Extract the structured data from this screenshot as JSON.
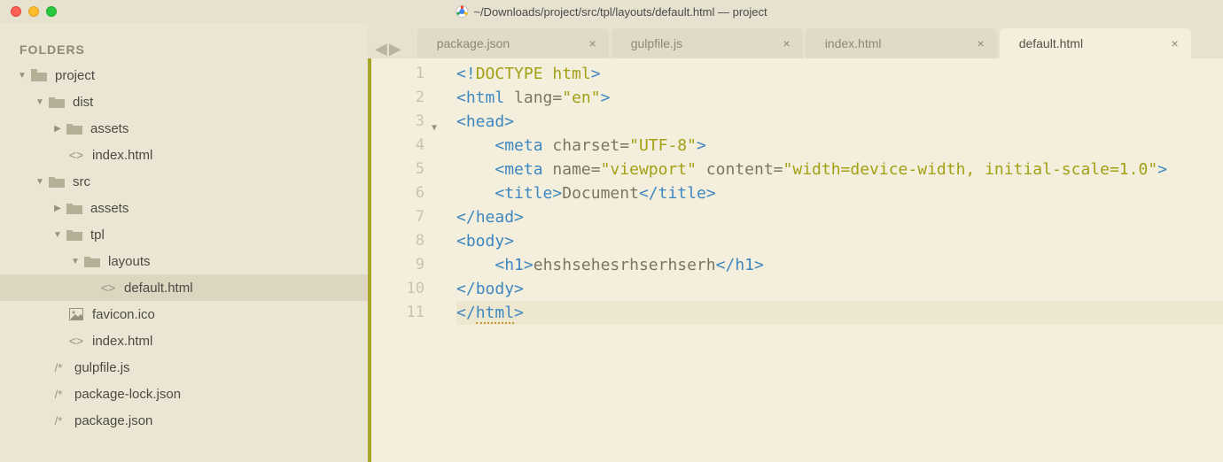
{
  "window_title": "~/Downloads/project/src/tpl/layouts/default.html — project",
  "sidebar_header": "FOLDERS",
  "tree": {
    "project": "project",
    "dist": "dist",
    "dist_assets": "assets",
    "dist_index": "index.html",
    "src": "src",
    "src_assets": "assets",
    "tpl": "tpl",
    "layouts": "layouts",
    "default_html": "default.html",
    "favicon": "favicon.ico",
    "src_index": "index.html",
    "gulpfile": "gulpfile.js",
    "pkglock": "package-lock.json",
    "pkg": "package.json"
  },
  "tabs": [
    {
      "label": "package.json"
    },
    {
      "label": "gulpfile.js"
    },
    {
      "label": "index.html"
    },
    {
      "label": "default.html"
    }
  ],
  "line_numbers": [
    "1",
    "2",
    "3",
    "4",
    "5",
    "6",
    "7",
    "8",
    "9",
    "10",
    "11"
  ],
  "code": {
    "l1_a": "<!",
    "l1_b": "DOCTYPE",
    "l1_c": " html",
    "l1_d": ">",
    "l2_a": "<",
    "l2_b": "html",
    "l2_c": " lang",
    "l2_d": "=",
    "l2_e": "\"en\"",
    "l2_f": ">",
    "l3_a": "<",
    "l3_b": "head",
    "l3_c": ">",
    "l4_a": "<",
    "l4_b": "meta",
    "l4_c": " charset",
    "l4_d": "=",
    "l4_e": "\"UTF-8\"",
    "l4_f": ">",
    "l5_a": "<",
    "l5_b": "meta",
    "l5_c": " name",
    "l5_d": "=",
    "l5_e": "\"viewport\"",
    "l5_f": " content",
    "l5_g": "=",
    "l5_h": "\"width=device-width, initial-scale=1.0\"",
    "l5_i": ">",
    "l6_a": "<",
    "l6_b": "title",
    "l6_c": ">",
    "l6_d": "Document",
    "l6_e": "</",
    "l6_f": "title",
    "l6_g": ">",
    "l7_a": "</",
    "l7_b": "head",
    "l7_c": ">",
    "l8_a": "<",
    "l8_b": "body",
    "l8_c": ">",
    "l9_a": "<",
    "l9_b": "h1",
    "l9_c": ">",
    "l9_d": "ehshsehesrhserhserh",
    "l9_e": "</",
    "l9_f": "h1",
    "l9_g": ">",
    "l10_a": "</",
    "l10_b": "body",
    "l10_c": ">",
    "l11_a": "</",
    "l11_b": "html",
    "l11_c": ">"
  }
}
